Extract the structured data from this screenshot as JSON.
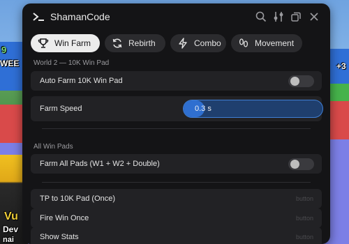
{
  "background": {
    "left_top_number": "9",
    "left_banner": "WEE",
    "right_banner": "+3",
    "char_name_1": "Vu",
    "char_name_2": "Dev",
    "char_name_3": "nai"
  },
  "window": {
    "title": "ShamanCode"
  },
  "tabs": [
    {
      "label": "Win Farm",
      "icon": "trophy-icon",
      "active": true
    },
    {
      "label": "Rebirth",
      "icon": "refresh-icon",
      "active": false
    },
    {
      "label": "Combo",
      "icon": "lightning-icon",
      "active": false
    },
    {
      "label": "Movement",
      "icon": "footprints-icon",
      "active": false
    }
  ],
  "sections": {
    "world2": {
      "label": "World 2 — 10K Win Pad",
      "auto_farm": {
        "label": "Auto Farm 10K Win Pad",
        "enabled": false
      },
      "farm_speed": {
        "label": "Farm Speed",
        "value": "0.3 s",
        "fraction": 0.15
      }
    },
    "all_pads": {
      "label": "All Win Pads",
      "farm_all": {
        "label": "Farm All Pads (W1 + W2 + Double)",
        "enabled": false
      }
    },
    "buttons": [
      {
        "label": "TP to 10K Pad (Once)",
        "hint": "button"
      },
      {
        "label": "Fire Win Once",
        "hint": "button"
      },
      {
        "label": "Show Stats",
        "hint": "button"
      }
    ]
  },
  "colors": {
    "panel_bg": "#141416",
    "row_bg": "#222225",
    "accent": "#2f6fd0",
    "active_tab": "#ececec"
  }
}
